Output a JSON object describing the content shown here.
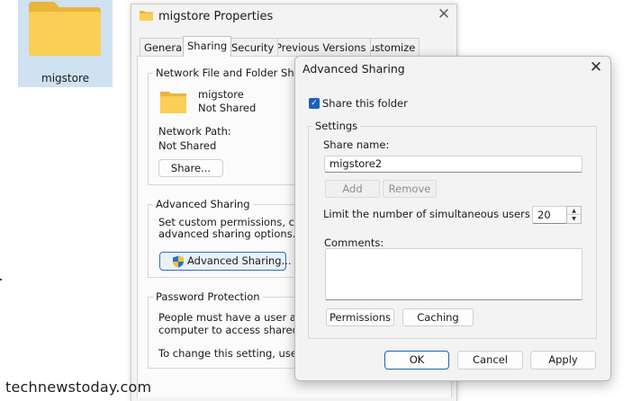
{
  "desktop": {
    "folder_label": "migstore"
  },
  "properties": {
    "title": "migstore Properties",
    "tabs": [
      "General",
      "Sharing",
      "Security",
      "Previous Versions",
      "Customize"
    ],
    "active_tab": "Sharing",
    "network_group": {
      "legend": "Network File and Folder Sharing",
      "folder_name": "migstore",
      "share_status": "Not Shared",
      "network_path_label": "Network Path:",
      "network_path_value": "Not Shared",
      "share_button": "Share..."
    },
    "advanced_group": {
      "legend": "Advanced Sharing",
      "desc_line1": "Set custom permissions, create m",
      "desc_line2": "advanced sharing options.",
      "button": "Advanced Sharing..."
    },
    "password_group": {
      "legend": "Password Protection",
      "line1": "People must have a user accou",
      "line2": "computer to access shared fold",
      "line3": "To change this setting, use the"
    }
  },
  "advanced_sharing": {
    "title": "Advanced Sharing",
    "share_checkbox_label": "Share this folder",
    "share_checked": true,
    "settings_legend": "Settings",
    "share_name_label": "Share name:",
    "share_name_value": "migstore2",
    "add_button": "Add",
    "remove_button": "Remove",
    "limit_label": "Limit the number of simultaneous users to:",
    "limit_value": "20",
    "comments_label": "Comments:",
    "comments_value": "",
    "permissions_button": "Permissions",
    "caching_button": "Caching",
    "ok_button": "OK",
    "cancel_button": "Cancel",
    "apply_button": "Apply"
  },
  "watermark": "technewstoday.com",
  "colors": {
    "accent": "#1b62b8",
    "folder_yellow": "#f7c948"
  }
}
